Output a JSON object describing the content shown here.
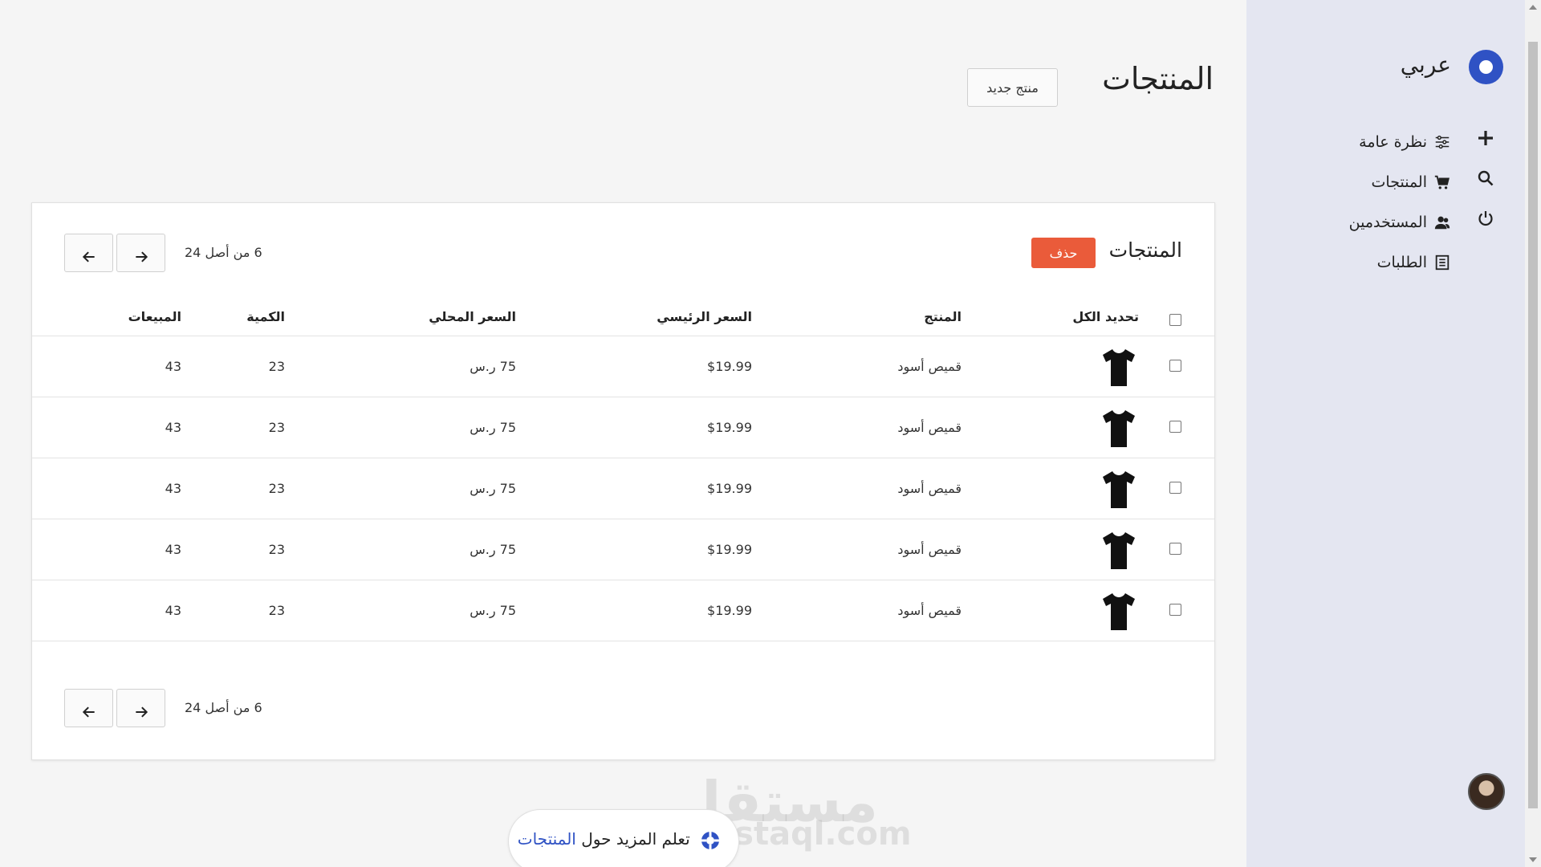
{
  "brand": {
    "name": "عربي"
  },
  "sidebar": {
    "items": [
      {
        "label": "نظرة عامة",
        "icon": "sliders-icon"
      },
      {
        "label": "المنتجات",
        "icon": "cart-icon"
      },
      {
        "label": "المستخدمين",
        "icon": "users-icon"
      },
      {
        "label": "الطلبات",
        "icon": "document-icon"
      }
    ],
    "actions": [
      "plus-icon",
      "search-icon",
      "power-icon"
    ]
  },
  "header": {
    "title": "المنتجات",
    "new_product_label": "منتج جديد"
  },
  "card": {
    "title": "المنتجات",
    "delete_label": "حذف",
    "pagination_text": "6 من أصل 24"
  },
  "table": {
    "headers": {
      "select_all": "تحديد الكل",
      "product": "المنتج",
      "price": "السعر الرئيسي",
      "local_price": "السعر المحلي",
      "quantity": "الكمية",
      "sales": "المبيعات"
    },
    "rows": [
      {
        "product": "قميص أسود",
        "price": "$19.99",
        "local_price": "75 ر.س",
        "quantity": "23",
        "sales": "43"
      },
      {
        "product": "قميص أسود",
        "price": "$19.99",
        "local_price": "75 ر.س",
        "quantity": "23",
        "sales": "43"
      },
      {
        "product": "قميص أسود",
        "price": "$19.99",
        "local_price": "75 ر.س",
        "quantity": "23",
        "sales": "43"
      },
      {
        "product": "قميص أسود",
        "price": "$19.99",
        "local_price": "75 ر.س",
        "quantity": "23",
        "sales": "43"
      },
      {
        "product": "قميص أسود",
        "price": "$19.99",
        "local_price": "75 ر.س",
        "quantity": "23",
        "sales": "43"
      }
    ]
  },
  "footer": {
    "learn_text": "تعلم المزيد حول",
    "learn_link": "المنتجات"
  },
  "watermark": {
    "arabic": "مستقل",
    "latin": "mostaql.com"
  },
  "colors": {
    "accent": "#2f52c4",
    "danger": "#ea5b3a",
    "sidebar_bg": "#e4e6f1"
  }
}
